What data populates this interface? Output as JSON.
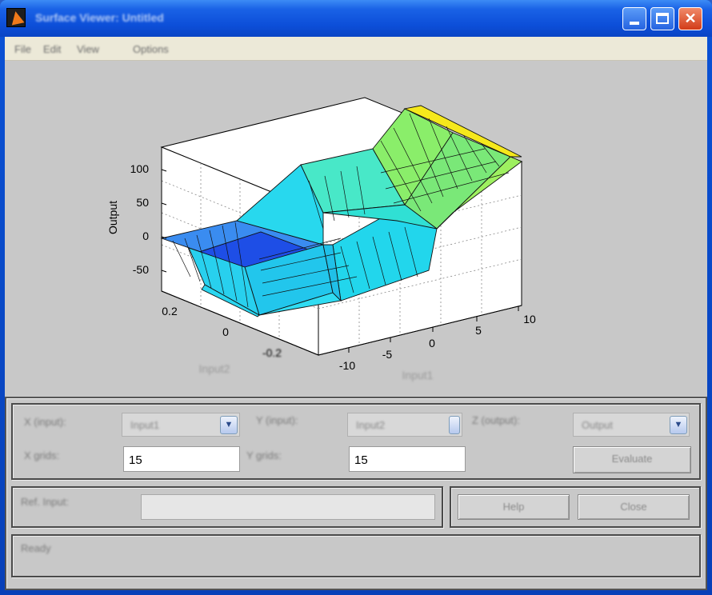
{
  "window": {
    "title": "Surface Viewer: Untitled"
  },
  "menu": {
    "items": [
      "File",
      "Edit",
      "View",
      "Options"
    ]
  },
  "plot": {
    "z_axis_label": "Output",
    "z_ticks": [
      "100",
      "50",
      "0",
      "-50"
    ],
    "x_ticks": [
      "-10",
      "-5",
      "0",
      "5",
      "10"
    ],
    "y_ticks": [
      "0.2",
      "0",
      "-0.2"
    ],
    "x_axis_label": "Input1",
    "y_axis_label": "Input2"
  },
  "controls": {
    "x_label": "X (input):",
    "x_value": "Input1",
    "y_label": "Y (input):",
    "y_value": "Input2",
    "z_label": "Z (output):",
    "z_value": "Output",
    "x_grids_label": "X grids:",
    "x_grids_value": "15",
    "y_grids_label": "Y grids:",
    "y_grids_value": "15",
    "evaluate_label": "Evaluate",
    "ref_label": "Ref. Input:",
    "ref_value": "",
    "help_label": "Help",
    "close_label": "Close",
    "status_line1": "Ready",
    "status_line2": ""
  },
  "colors": {
    "titlebar": "#0c4ed8",
    "figure_bg": "#c8c8c8",
    "surface_high": "#f5e81c",
    "surface_low": "#1e4ee6"
  }
}
